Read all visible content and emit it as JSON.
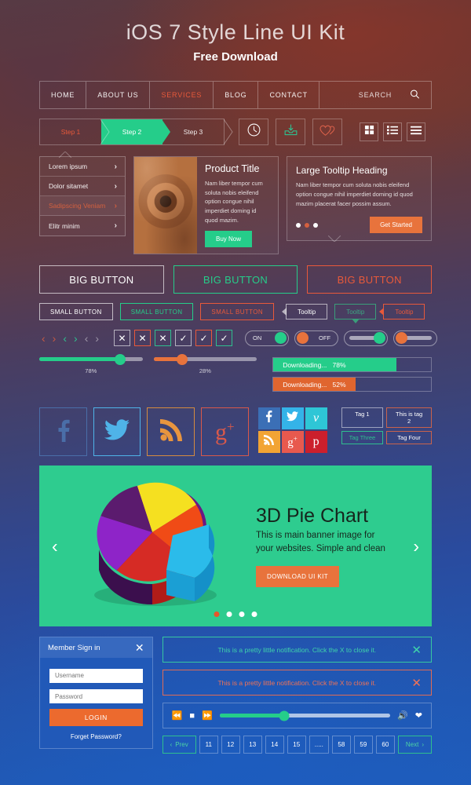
{
  "hero": {
    "title": "iOS 7 Style Line UI Kit",
    "subtitle": "Free Download"
  },
  "nav": {
    "items": [
      {
        "label": "HOME",
        "active": false
      },
      {
        "label": "ABOUT US",
        "active": false
      },
      {
        "label": "SERVICES",
        "active": true
      },
      {
        "label": "BLOG",
        "active": false
      },
      {
        "label": "CONTACT",
        "active": false
      }
    ],
    "search_label": "SEARCH",
    "search_icon": "search-icon"
  },
  "steps": {
    "items": [
      {
        "label": "Step 1",
        "state": "done"
      },
      {
        "label": "Step 2",
        "state": "current"
      },
      {
        "label": "Step 3",
        "state": "todo"
      }
    ]
  },
  "toolbar_icons": [
    {
      "name": "clock-icon",
      "color": "#ffffff"
    },
    {
      "name": "download-inbox-icon",
      "color": "#2fbf8f"
    },
    {
      "name": "hearts-icon",
      "color": "#d9604a"
    }
  ],
  "view_toggles": [
    {
      "name": "grid-view-icon"
    },
    {
      "name": "list-view-icon"
    },
    {
      "name": "menu-view-icon"
    }
  ],
  "menu_card": {
    "items": [
      {
        "label": "Lorem ipsum",
        "active": false
      },
      {
        "label": "Dolor sitamet",
        "active": false
      },
      {
        "label": "Sadipscing Veniam",
        "active": true
      },
      {
        "label": "Elitr minim",
        "active": false
      }
    ]
  },
  "product_card": {
    "title": "Product Title",
    "body": "Nam liber tempor cum soluta nobis eleifend option congue nihil imperdiet doming id quod mazim.",
    "button": "Buy Now"
  },
  "tooltip_card": {
    "title": "Large Tooltip Heading",
    "body": "Nam liber tempor cum soluta nobis eleifend option congue nihil imperdiet doming id quod mazim placerat facer possim assum.",
    "dots": [
      false,
      true,
      false
    ],
    "button": "Get Started"
  },
  "big_buttons": [
    {
      "label": "BIG BUTTON",
      "style": "white"
    },
    {
      "label": "BIG BUTTON",
      "style": "green"
    },
    {
      "label": "BIG BUTTON",
      "style": "red"
    }
  ],
  "small_buttons": [
    {
      "label": "SMALL BUTTON",
      "style": "white"
    },
    {
      "label": "SMALL BUTTON",
      "style": "green"
    },
    {
      "label": "SMALL BUTTON",
      "style": "red"
    }
  ],
  "tooltips": [
    {
      "label": "Tooltip",
      "style": "white",
      "tail": "left"
    },
    {
      "label": "Tooltip",
      "style": "green",
      "tail": "down"
    },
    {
      "label": "Tooltip",
      "style": "red",
      "tail": "left"
    }
  ],
  "arrows": [
    {
      "name": "chevron-left-icon",
      "color": "red"
    },
    {
      "name": "chevron-right-icon",
      "color": "red"
    },
    {
      "name": "chevron-left-icon",
      "color": "green"
    },
    {
      "name": "chevron-right-icon",
      "color": "green"
    },
    {
      "name": "chevron-left-icon",
      "color": "grey"
    },
    {
      "name": "chevron-right-icon",
      "color": "grey"
    }
  ],
  "boxes": [
    {
      "glyph": "✕",
      "name": "close-box-icon",
      "style": "white"
    },
    {
      "glyph": "✕",
      "name": "close-box-icon",
      "style": "red"
    },
    {
      "glyph": "✕",
      "name": "close-box-icon",
      "style": "green"
    },
    {
      "glyph": "✓",
      "name": "check-box-icon",
      "style": "white"
    },
    {
      "glyph": "✓",
      "name": "check-box-icon",
      "style": "red"
    },
    {
      "glyph": "✓",
      "name": "check-box-icon",
      "style": "green"
    }
  ],
  "toggles": {
    "on_label": "ON",
    "off_label": "OFF"
  },
  "sliders": [
    {
      "value": 78,
      "label": "78%",
      "color": "#25cd8a"
    },
    {
      "value": 28,
      "label": "28%",
      "color": "#e8733c"
    }
  ],
  "progress": [
    {
      "label": "Downloading...",
      "percent_label": "78%",
      "value": 78,
      "color": "#25cd8a"
    },
    {
      "label": "Downloading...",
      "percent_label": "52%",
      "value": 52,
      "color": "#e0652f"
    }
  ],
  "social_outline": [
    {
      "name": "facebook-icon",
      "glyph": "f",
      "color": "#4a6ea8"
    },
    {
      "name": "twitter-icon",
      "glyph": "t",
      "color": "#4fb3e8"
    },
    {
      "name": "rss-icon",
      "glyph": "r",
      "color": "#e8953f"
    },
    {
      "name": "google-plus-icon",
      "glyph": "g+",
      "color": "#d9594a"
    }
  ],
  "social_grid": [
    {
      "name": "facebook-icon",
      "glyph": "f",
      "bg": "#3b6fb6"
    },
    {
      "name": "twitter-icon",
      "glyph": "t",
      "bg": "#34b3e8"
    },
    {
      "name": "vimeo-icon",
      "glyph": "v",
      "bg": "#2ec6d6"
    },
    {
      "name": "rss-icon",
      "glyph": "r",
      "bg": "#f2a434"
    },
    {
      "name": "google-plus-icon",
      "glyph": "g+",
      "bg": "#e8594e"
    },
    {
      "name": "pinterest-icon",
      "glyph": "p",
      "bg": "#cc1f2c"
    }
  ],
  "tags": [
    {
      "label": "Tag 1",
      "style": "white"
    },
    {
      "label": "This is tag 2",
      "style": "red"
    },
    {
      "label": "Tag Three",
      "style": "green"
    },
    {
      "label": "Tag Four",
      "style": "orange"
    }
  ],
  "banner": {
    "title": "3D Pie Chart",
    "body": "This is main banner image for your websites. Simple and clean",
    "button": "DOWNLOAD UI KIT",
    "prev_icon": "chevron-left-icon",
    "next_icon": "chevron-right-icon",
    "bg_color": "#2ecc8f",
    "dots": [
      true,
      false,
      false,
      false
    ]
  },
  "chart_data": {
    "type": "pie",
    "title": "3D Pie Chart",
    "labels": [
      "Yellow",
      "Cyan",
      "Red",
      "Purple",
      "Orange",
      "Dark Purple"
    ],
    "values": [
      20,
      22,
      18,
      16,
      12,
      12
    ],
    "colors": [
      "#f5e020",
      "#2bbbea",
      "#d62b25",
      "#8e24c8",
      "#f04b16",
      "#5b1b6e"
    ],
    "legend": "none",
    "style": "3d-exploded"
  },
  "signin": {
    "title": "Member Sign in",
    "close_icon": "close-icon",
    "username_placeholder": "Username",
    "password_placeholder": "Password",
    "login_label": "LOGIN",
    "forget_label": "Forget Password?"
  },
  "notifications": [
    {
      "text": "This is a pretty little notification. Click the X to close it.",
      "style": "green",
      "close_icon": "close-icon"
    },
    {
      "text": "This is a pretty little notification. Click the X to close it.",
      "style": "red",
      "close_icon": "close-icon"
    }
  ],
  "player": {
    "rewind_icon": "rewind-icon",
    "stop_icon": "stop-icon",
    "forward_icon": "fast-forward-icon",
    "volume_icon": "volume-icon",
    "favorite_icon": "heart-icon",
    "progress": 38
  },
  "pager": {
    "prev_label": "Prev",
    "next_label": "Next",
    "pages": [
      "11",
      "12",
      "13",
      "14",
      "15",
      ".....",
      "58",
      "59",
      "60"
    ]
  }
}
